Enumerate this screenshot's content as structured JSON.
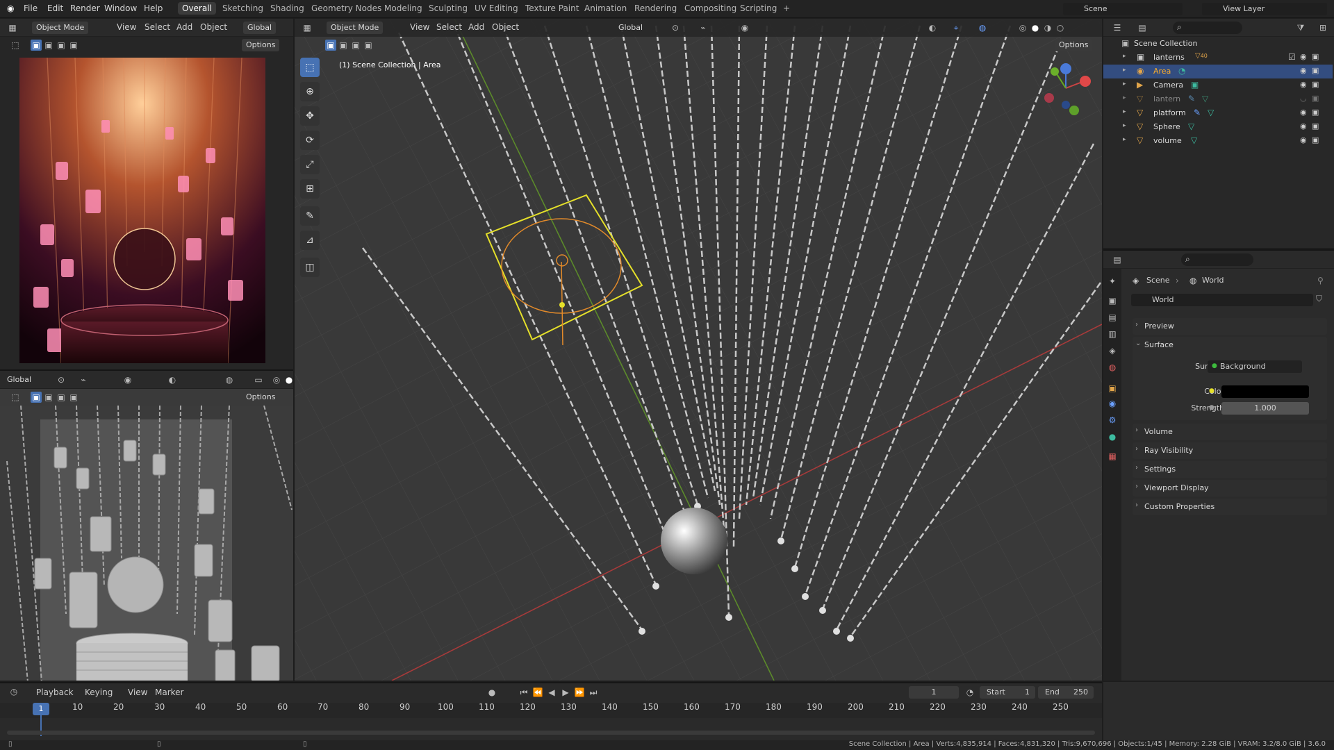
{
  "menu": [
    "File",
    "Edit",
    "Render",
    "Window",
    "Help"
  ],
  "workspaces": [
    "Overall",
    "Sketching",
    "Shading",
    "Geometry Nodes",
    "Modeling",
    "Sculpting",
    "UV Editing",
    "Texture Paint",
    "Animation",
    "Rendering",
    "Compositing",
    "Scripting"
  ],
  "active_workspace": "Overall",
  "scene_name": "Scene",
  "view_layer": "View Layer",
  "left_header": {
    "mode": "Object Mode",
    "view": "View",
    "select": "Select",
    "add": "Add",
    "object": "Object",
    "transform": "Global",
    "options": "Options"
  },
  "bottom_left_header": {
    "transform": "Global",
    "options": "Options"
  },
  "main_header": {
    "mode": "Object Mode",
    "view": "View",
    "select": "Select",
    "add": "Add",
    "object": "Object",
    "transform": "Global",
    "options": "Options"
  },
  "viewport_info": "(1) Scene Collection | Area",
  "outliner": {
    "root": "Scene Collection",
    "items": [
      {
        "name": "lanterns",
        "badge": "40",
        "selected": false,
        "dim": false
      },
      {
        "name": "Area",
        "badge": "",
        "selected": true,
        "dim": false
      },
      {
        "name": "Camera",
        "badge": "",
        "selected": false,
        "dim": false
      },
      {
        "name": "lantern",
        "badge": "",
        "selected": false,
        "dim": true
      },
      {
        "name": "platform",
        "badge": "",
        "selected": false,
        "dim": false
      },
      {
        "name": "Sphere",
        "badge": "",
        "selected": false,
        "dim": false
      },
      {
        "name": "volume",
        "badge": "",
        "selected": false,
        "dim": false
      }
    ]
  },
  "properties": {
    "breadcrumb_scene": "Scene",
    "breadcrumb_world": "World",
    "world_name": "World",
    "sections": [
      "Preview",
      "Surface",
      "Volume",
      "Ray Visibility",
      "Settings",
      "Viewport Display",
      "Custom Properties"
    ],
    "surface_label": "Surface",
    "surface_value": "Background",
    "color_label": "Color",
    "color_value": "#000000",
    "strength_label": "Strength",
    "strength_value": "1.000"
  },
  "timeline": {
    "playback": "Playback",
    "keying": "Keying",
    "view": "View",
    "marker": "Marker",
    "current_frame": "1",
    "start_label": "Start",
    "start": "1",
    "end_label": "End",
    "end": "250",
    "ticks": [
      "1",
      "10",
      "20",
      "30",
      "40",
      "50",
      "60",
      "70",
      "80",
      "90",
      "100",
      "110",
      "120",
      "130",
      "140",
      "150",
      "160",
      "170",
      "180",
      "190",
      "200",
      "210",
      "220",
      "230",
      "240",
      "250"
    ]
  },
  "status": "Scene Collection | Area | Verts:4,835,914 | Faces:4,831,320 | Tris:9,670,696 | Objects:1/45 | Memory: 2.28 GiB | VRAM: 3.2/8.0 GiB | 3.6.0",
  "colors": {
    "accent": "#4772b3",
    "selection": "#334d80",
    "render_warm": "#c46a3a"
  }
}
